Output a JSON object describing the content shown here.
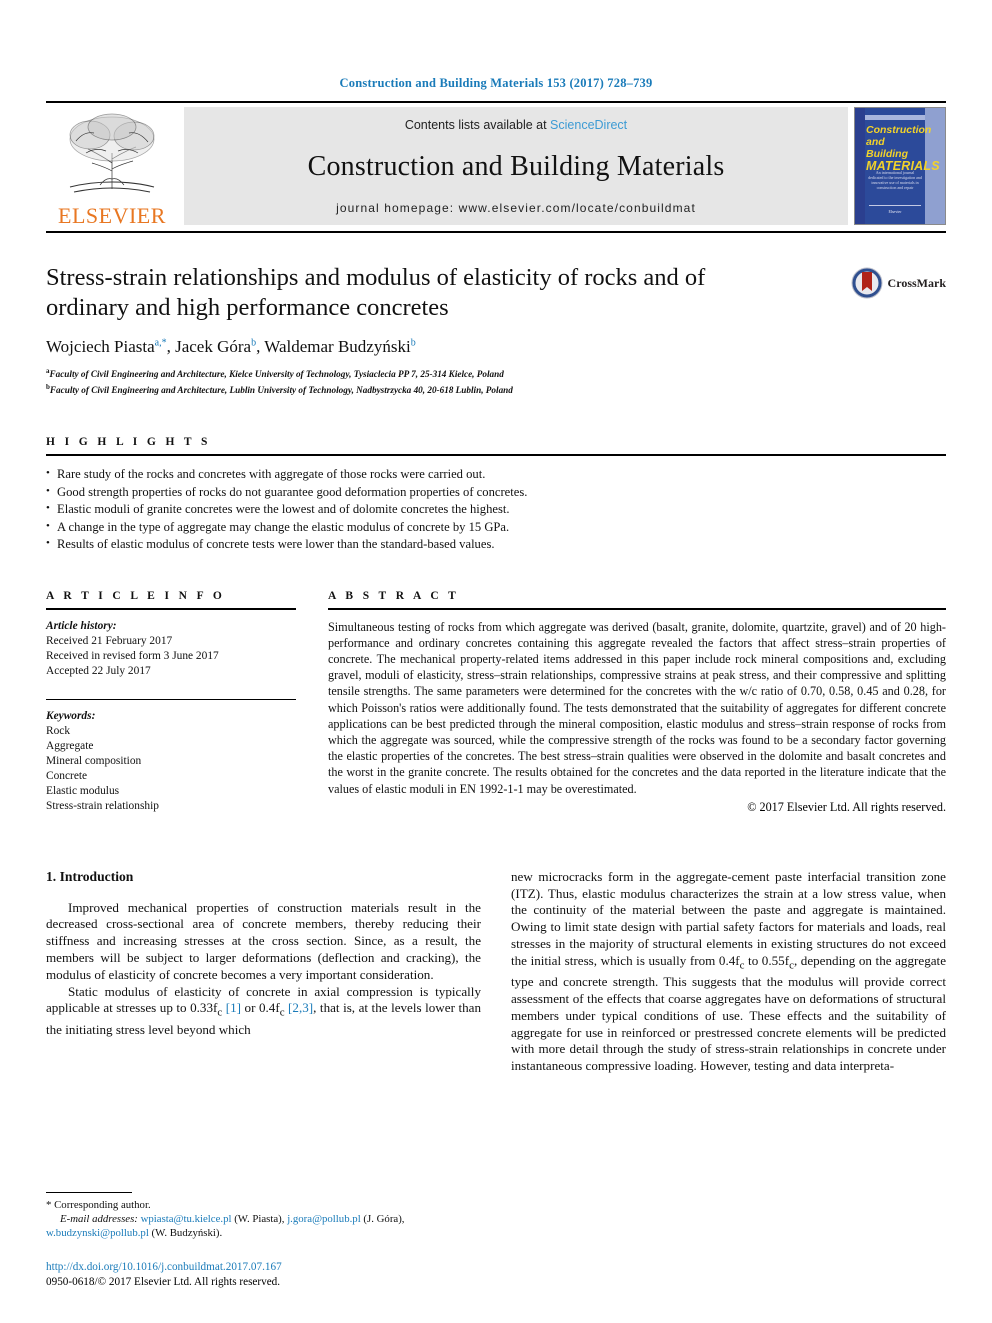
{
  "running_head": "Construction and Building Materials 153 (2017) 728–739",
  "masthead": {
    "contents_prefix": "Contents lists available at ",
    "sciencedirect": "ScienceDirect",
    "journal_name": "Construction and Building Materials",
    "homepage": "journal homepage: www.elsevier.com/locate/conbuildmat",
    "publisher": "ELSEVIER",
    "cover": {
      "line1": "Construction",
      "line2": "and Building",
      "line3": "MATERIALS",
      "blurb": "An international journal dedicated to the investigation and innovative use of materials in construction and repair",
      "foot": "Elsevier"
    }
  },
  "article": {
    "title": "Stress-strain relationships and modulus of elasticity of rocks and of ordinary and high performance concretes",
    "crossmark_label": "CrossMark",
    "authors": [
      {
        "name": "Wojciech Piasta",
        "sup": "a,*"
      },
      {
        "name": "Jacek Góra",
        "sup": "b"
      },
      {
        "name": "Waldemar Budzyński",
        "sup": "b"
      }
    ],
    "affiliations": [
      {
        "marker": "a",
        "text": "Faculty of Civil Engineering and Architecture, Kielce University of Technology, Tysiaclecia PP 7, 25-314 Kielce, Poland"
      },
      {
        "marker": "b",
        "text": "Faculty of Civil Engineering and Architecture, Lublin University of Technology, Nadbystrzycka 40, 20-618 Lublin, Poland"
      }
    ]
  },
  "highlights": {
    "heading": "H I G H L I G H T S",
    "items": [
      "Rare study of the rocks and concretes with aggregate of those rocks were carried out.",
      "Good strength properties of rocks do not guarantee good deformation properties of concretes.",
      "Elastic moduli of granite concretes were the lowest and of dolomite concretes the highest.",
      "A change in the type of aggregate may change the elastic modulus of concrete by 15 GPa.",
      "Results of elastic modulus of concrete tests were lower than the standard-based values."
    ]
  },
  "article_info": {
    "heading": "A R T I C L E    I N F O",
    "history_label": "Article history:",
    "history": [
      "Received 21 February 2017",
      "Received in revised form 3 June 2017",
      "Accepted 22 July 2017"
    ],
    "keywords_label": "Keywords:",
    "keywords": [
      "Rock",
      "Aggregate",
      "Mineral composition",
      "Concrete",
      "Elastic modulus",
      "Stress-strain relationship"
    ]
  },
  "abstract": {
    "heading": "A B S T R A C T",
    "text": "Simultaneous testing of rocks from which aggregate was derived (basalt, granite, dolomite, quartzite, gravel) and of 20 high-performance and ordinary concretes containing this aggregate revealed the factors that affect stress–strain properties of concrete. The mechanical property-related items addressed in this paper include rock mineral compositions and, excluding gravel, moduli of elasticity, stress–strain relationships, compressive strains at peak stress, and their compressive and splitting tensile strengths. The same parameters were determined for the concretes with the w/c ratio of 0.70, 0.58, 0.45 and 0.28, for which Poisson's ratios were additionally found. The tests demonstrated that the suitability of aggregates for different concrete applications can be best predicted through the mineral composition, elastic modulus and stress–strain response of rocks from which the aggregate was sourced, while the compressive strength of the rocks was found to be a secondary factor governing the elastic properties of the concretes. The best stress–strain qualities were observed in the dolomite and basalt concretes and the worst in the granite concrete. The results obtained for the concretes and the data reported in the literature indicate that the values of elastic moduli in EN 1992-1-1 may be overestimated.",
    "copyright": "© 2017 Elsevier Ltd. All rights reserved."
  },
  "introduction": {
    "heading": "1. Introduction",
    "left_p1": "Improved mechanical properties of construction materials result in the decreased cross-sectional area of concrete members, thereby reducing their stiffness and increasing stresses at the cross section. Since, as a result, the members will be subject to larger deformations (deflection and cracking), the modulus of elasticity of concrete becomes a very important consideration.",
    "left_p2_a": "Static modulus of elasticity of concrete in axial compression is typically applicable at stresses up to 0.33f",
    "left_p2_ref1": "[1]",
    "left_p2_b": " or 0.4f",
    "left_p2_ref2": "[2,3]",
    "left_p2_c": ", that is, at the levels lower than the initiating stress level beyond which",
    "right_p1_a": "new microcracks form in the aggregate-cement paste interfacial transition zone (ITZ). Thus, elastic modulus characterizes the strain at a low stress value, when the continuity of the material between the paste and aggregate is maintained. Owing to limit state design with partial safety factors for materials and loads, real stresses in the majority of structural elements in existing structures do not exceed the initial stress, which is usually from 0.4f",
    "right_p1_b": " to 0.55f",
    "right_p1_c": ", depending on the aggregate type and concrete strength. This suggests that the modulus will provide correct assessment of the effects that coarse aggregates have on deformations of structural members under typical conditions of use. These effects and the suitability of aggregate for use in reinforced or prestressed concrete elements will be predicted with more detail through the study of stress-strain relationships in concrete under instantaneous compressive loading. However, testing and data interpreta-",
    "subscript_c": "c"
  },
  "footnote": {
    "corresponding": "* Corresponding author.",
    "email_label": "E-mail addresses:",
    "emails": [
      {
        "address": "wpiasta@tu.kielce.pl",
        "owner": "(W. Piasta)"
      },
      {
        "address": "j.gora@pollub.pl",
        "owner": "(J. Góra)"
      },
      {
        "address": "w.budzynski@pollub.pl",
        "owner": "(W. Budzyński)"
      }
    ],
    "doi": "http://dx.doi.org/10.1016/j.conbuildmat.2017.07.167",
    "issn_line": "0950-0618/© 2017 Elsevier Ltd. All rights reserved."
  },
  "colors": {
    "link_blue": "#1a7bb9",
    "sciencedirect_blue": "#3d9bd4",
    "elsevier_orange": "#E87722",
    "cover_blue": "#2c4a9a",
    "cover_yellow": "#f2d22a"
  }
}
